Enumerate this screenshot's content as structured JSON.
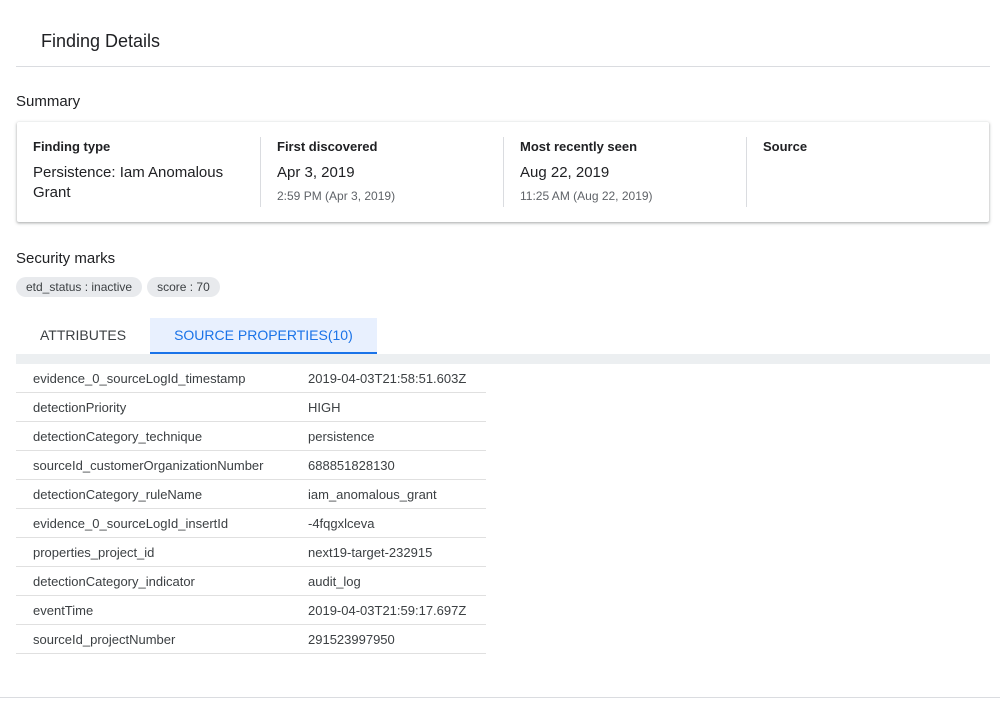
{
  "header": {
    "title": "Finding Details"
  },
  "summary": {
    "title": "Summary",
    "finding_type": {
      "label": "Finding type",
      "value": "Persistence: Iam Anomalous Grant"
    },
    "first_discovered": {
      "label": "First discovered",
      "value": "Apr 3, 2019",
      "sub": "2:59 PM (Apr 3, 2019)"
    },
    "most_recently_seen": {
      "label": "Most recently seen",
      "value": "Aug 22, 2019",
      "sub": "11:25 AM (Aug 22, 2019)"
    },
    "source": {
      "label": "Source"
    }
  },
  "security_marks": {
    "title": "Security marks",
    "chips": [
      "etd_status : inactive",
      "score : 70"
    ]
  },
  "tabs": [
    {
      "label": "ATTRIBUTES",
      "active": false
    },
    {
      "label": "SOURCE PROPERTIES(10)",
      "active": true
    }
  ],
  "source_properties": [
    {
      "key": "evidence_0_sourceLogId_timestamp",
      "value": "2019-04-03T21:58:51.603Z"
    },
    {
      "key": "detectionPriority",
      "value": "HIGH"
    },
    {
      "key": "detectionCategory_technique",
      "value": "persistence"
    },
    {
      "key": "sourceId_customerOrganizationNumber",
      "value": "688851828130"
    },
    {
      "key": "detectionCategory_ruleName",
      "value": "iam_anomalous_grant"
    },
    {
      "key": "evidence_0_sourceLogId_insertId",
      "value": "-4fqgxlceva"
    },
    {
      "key": "properties_project_id",
      "value": "next19-target-232915"
    },
    {
      "key": "detectionCategory_indicator",
      "value": "audit_log"
    },
    {
      "key": "eventTime",
      "value": "2019-04-03T21:59:17.697Z"
    },
    {
      "key": "sourceId_projectNumber",
      "value": "291523997950"
    }
  ],
  "colors": {
    "accent": "#1a73e8",
    "tab_active_bg": "#e8f0fe",
    "chip_bg": "#e8eaed",
    "divider": "#dadce0"
  }
}
